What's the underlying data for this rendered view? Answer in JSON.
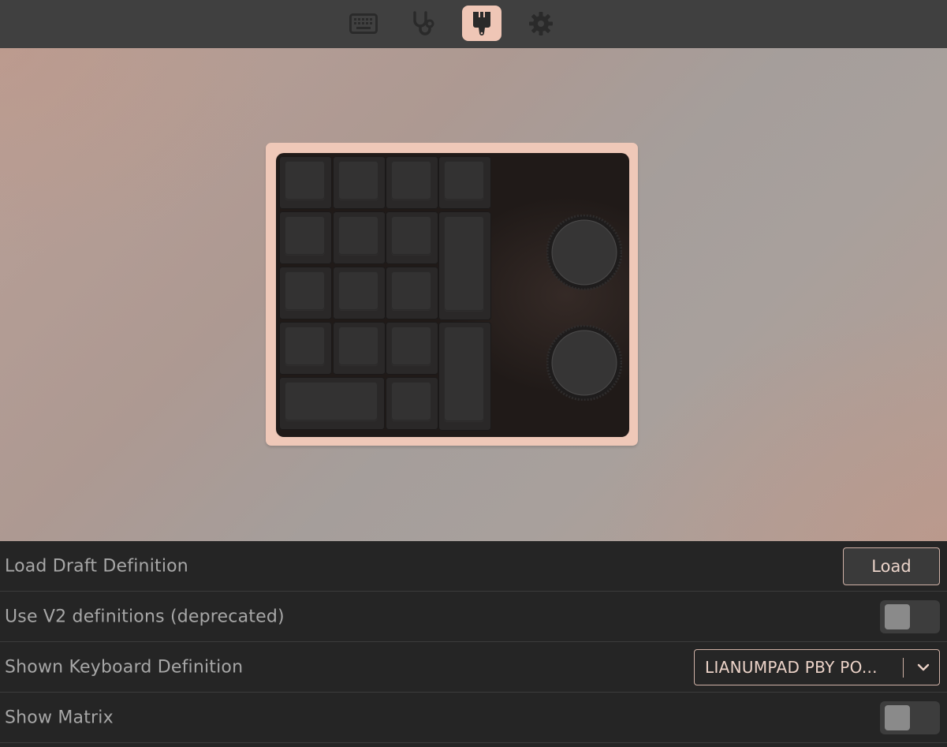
{
  "nav": {
    "tabs": [
      {
        "icon": "keyboard-icon",
        "active": false
      },
      {
        "icon": "stethoscope-icon",
        "active": false
      },
      {
        "icon": "paintbrush-icon",
        "active": true
      },
      {
        "icon": "gear-icon",
        "active": false
      }
    ]
  },
  "colors": {
    "accent": "#efc6b6",
    "case": "#efc8b8",
    "background": "#252525",
    "label": "#a7a7a7"
  },
  "settings": {
    "load_draft": {
      "label": "Load Draft Definition",
      "button_label": "Load"
    },
    "use_v2": {
      "label": "Use V2 definitions (deprecated)",
      "enabled": false
    },
    "shown_definition": {
      "label": "Shown Keyboard Definition",
      "value": "LIANUMPAD PBY PO..."
    },
    "show_matrix": {
      "label": "Show Matrix",
      "enabled": false
    }
  }
}
